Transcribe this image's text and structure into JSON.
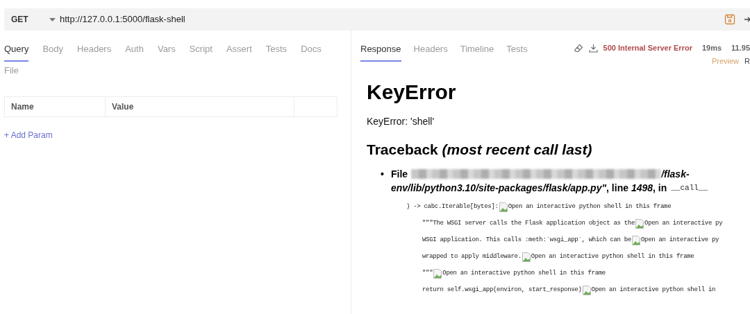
{
  "request": {
    "method": "GET",
    "url": "http://127.0.0.1:5000/flask-shell"
  },
  "request_tabs": [
    {
      "label": "Query",
      "selected": true
    },
    {
      "label": "Body",
      "selected": false
    },
    {
      "label": "Headers",
      "selected": false
    },
    {
      "label": "Auth",
      "selected": false
    },
    {
      "label": "Vars",
      "selected": false
    },
    {
      "label": "Script",
      "selected": false
    },
    {
      "label": "Assert",
      "selected": false
    },
    {
      "label": "Tests",
      "selected": false
    },
    {
      "label": "Docs",
      "selected": false
    },
    {
      "label": "File",
      "selected": false
    }
  ],
  "params_table": {
    "columns": [
      "Name",
      "Value"
    ]
  },
  "add_param": "+ Add Param",
  "response_tabs": [
    {
      "label": "Response",
      "selected": true
    },
    {
      "label": "Headers",
      "selected": false
    },
    {
      "label": "Timeline",
      "selected": false
    },
    {
      "label": "Tests",
      "selected": false
    }
  ],
  "status": {
    "text": "500 Internal Server Error",
    "time": "19ms",
    "size": "11.95"
  },
  "view_modes": [
    {
      "label": "Preview",
      "selected": true
    },
    {
      "label": "R",
      "selected": false
    }
  ],
  "preview": {
    "title": "KeyError",
    "message": "KeyError: 'shell'",
    "traceback_heading": "Traceback *(most recent call last)*",
    "frame": {
      "bullet": "•",
      "file_label": "File",
      "path_start": "/flask-",
      "location": "*env/lib/python3.10/site-packages/flask/app.py\"*, line *1498*, in",
      "function": "__call__"
    },
    "lines": [
      {
        "kind": "signature",
        "code": ") -> cabc.Iterable[bytes]:",
        "alt": "Open an interactive python shell in this frame"
      },
      {
        "kind": "body",
        "code": "\"\"\"The WSGI server calls the Flask application object as the",
        "alt": "Open an interactive py"
      },
      {
        "kind": "body",
        "code": "WSGI application. This calls :meth:`wsgi_app`, which can be",
        "alt": "Open an interactive py"
      },
      {
        "kind": "body",
        "code": "wrapped to apply middleware.",
        "alt": "Open an interactive python shell in this frame"
      },
      {
        "kind": "body",
        "code": "\"\"\"",
        "alt": "Open an interactive python shell in this frame"
      },
      {
        "kind": "body",
        "code": "return self.wsgi_app(environ, start_response)",
        "alt": "Open an interactive python shell in"
      }
    ]
  }
}
